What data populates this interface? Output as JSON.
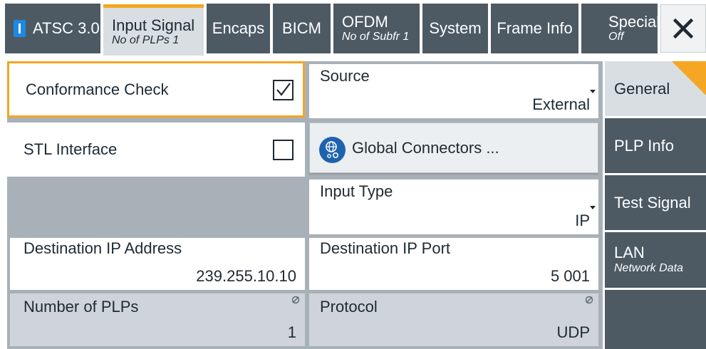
{
  "tabs": [
    {
      "label": "ATSC 3.0",
      "sub": ""
    },
    {
      "label": "Input Signal",
      "sub": "No of PLPs 1"
    },
    {
      "label": "Encaps",
      "sub": ""
    },
    {
      "label": "BICM",
      "sub": ""
    },
    {
      "label": "OFDM",
      "sub": "No of Subfr 1"
    },
    {
      "label": "System",
      "sub": ""
    },
    {
      "label": "Frame Info",
      "sub": ""
    },
    {
      "label": "Special",
      "sub": "Off"
    }
  ],
  "active_tab": "Input Signal",
  "close_icon": "close-icon",
  "form": {
    "conformance_check": {
      "label": "Conformance Check",
      "checked": true
    },
    "stl_interface": {
      "label": "STL Interface",
      "checked": false
    },
    "source": {
      "label": "Source",
      "value": "External"
    },
    "global_connectors": {
      "label": "Global Connectors ...",
      "icon": "global-connectors-icon"
    },
    "input_type": {
      "label": "Input Type",
      "value": "IP"
    },
    "dest_ip_address": {
      "label": "Destination IP Address",
      "value": "239.255.10.10"
    },
    "dest_ip_port": {
      "label": "Destination IP Port",
      "value": "5 001"
    },
    "num_plps": {
      "label": "Number of PLPs",
      "value": "1"
    },
    "protocol": {
      "label": "Protocol",
      "value": "UDP"
    }
  },
  "side_tabs": [
    {
      "label": "General",
      "sub": ""
    },
    {
      "label": "PLP Info",
      "sub": ""
    },
    {
      "label": "Test Signal",
      "sub": ""
    },
    {
      "label": "LAN",
      "sub": "Network Data"
    }
  ],
  "active_side_tab": "General",
  "colors": {
    "accent": "#f5a623",
    "tab_bg": "#4d5a64",
    "tab_active_bg": "#d9dee2",
    "panel_bg": "#a9b1b8",
    "readonly_bg": "#ced4d9",
    "atsc_mark": "#1e88e5"
  }
}
